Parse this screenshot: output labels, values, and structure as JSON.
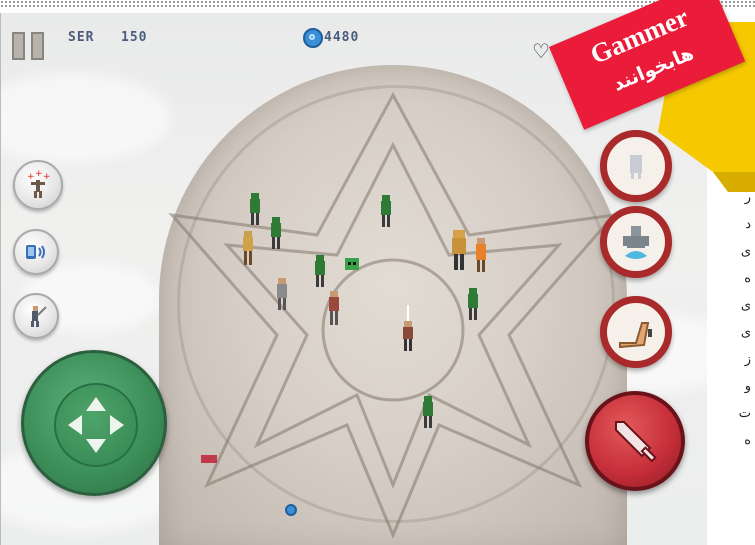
{
  "hud": {
    "label_1": "SER",
    "label_2": "150",
    "coins": "4480"
  },
  "banner": {
    "title": "Gammer",
    "subtitle": "هابخوانند",
    "color": "#ea1c3a",
    "accent": "#f5c800"
  },
  "side_text": [
    "ر",
    "د",
    "ی",
    "ه",
    "ی",
    "ی",
    "ز",
    "و",
    "ت",
    "ه"
  ],
  "controls": {
    "left_buttons": [
      "aim-targets-icon",
      "phone-signal-icon",
      "swordsman-icon"
    ],
    "abilities": [
      "ghost-icon",
      "water-elemental-icon",
      "kick-icon"
    ],
    "attack": "sword-icon",
    "dpad": "dpad-arrows-icon"
  },
  "colors": {
    "stone": "#d7cfc7",
    "dpad_green": "#3b8d58",
    "attack_red": "#c72f3a",
    "ability_border": "#a82a2a",
    "enemy_green": "#2f7a35"
  }
}
